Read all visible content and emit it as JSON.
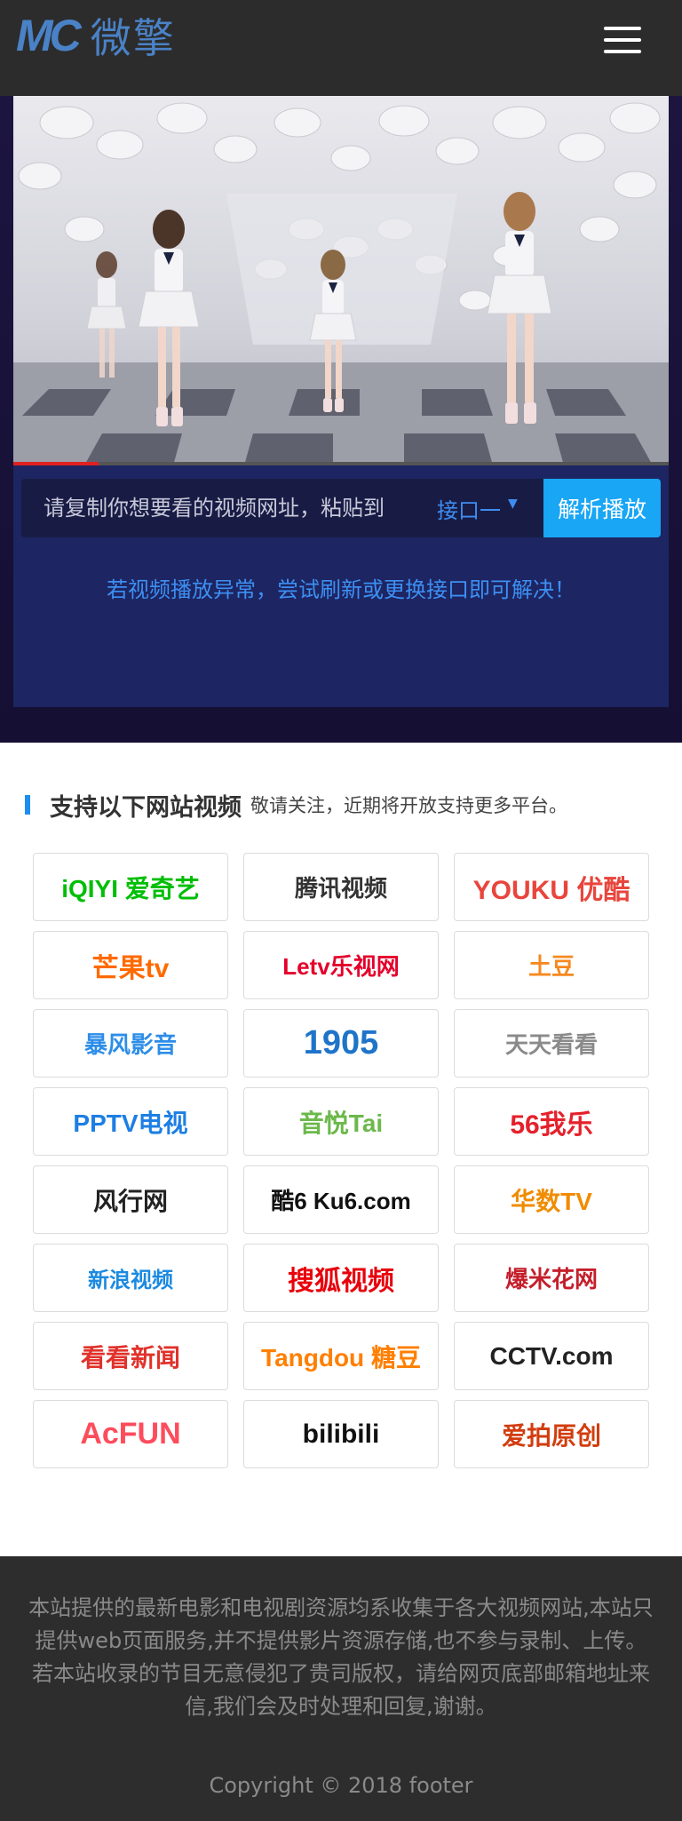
{
  "header": {
    "logo_mark": "MC",
    "logo_text": "微擎"
  },
  "player": {
    "progress": 0.13
  },
  "parse": {
    "placeholder": "请复制你想要看的视频网址，粘贴到",
    "interface_label": "接口一",
    "button_label": "解析播放",
    "tip": "若视频播放异常，尝试刷新或更换接口即可解决！"
  },
  "sites": {
    "title": "支持以下网站视频",
    "subtitle": "敬请关注，近期将开放支持更多平台。",
    "items": [
      {
        "label": "iQIYI 爱奇艺",
        "color": "#00be06"
      },
      {
        "label": "腾讯视频",
        "color": "#333333"
      },
      {
        "label": "YOUKU 优酷",
        "color": "#e8453c"
      },
      {
        "label": "芒果tv",
        "color": "#ff6a00"
      },
      {
        "label": "Letv乐视网",
        "color": "#e4002b"
      },
      {
        "label": "土豆",
        "color": "#f6891f"
      },
      {
        "label": "暴风影音",
        "color": "#2d8ee8"
      },
      {
        "label": "1905",
        "color": "#1f74c9"
      },
      {
        "label": "天天看看",
        "color": "#8a8a8a"
      },
      {
        "label": "PPTV电视",
        "color": "#1d7fe3"
      },
      {
        "label": "音悦Tai",
        "color": "#6cb84b"
      },
      {
        "label": "56我乐",
        "color": "#e5212b"
      },
      {
        "label": "风行网",
        "color": "#222222"
      },
      {
        "label": "酷6 Ku6.com",
        "color": "#111111"
      },
      {
        "label": "华数TV",
        "color": "#f08c00"
      },
      {
        "label": "新浪视频",
        "color": "#1b8ae0"
      },
      {
        "label": "搜狐视频",
        "color": "#e8000b"
      },
      {
        "label": "爆米花网",
        "color": "#c41f2b"
      },
      {
        "label": "看看新闻",
        "color": "#e0322b"
      },
      {
        "label": "Tangdou 糖豆",
        "color": "#ff7f00"
      },
      {
        "label": "CCTV.com",
        "color": "#222222"
      },
      {
        "label": "AcFUN",
        "color": "#fd4c5c"
      },
      {
        "label": "bilibili",
        "color": "#111111"
      },
      {
        "label": "爱拍原创",
        "color": "#d23d0f"
      }
    ]
  },
  "footer": {
    "text1": "本站提供的最新电影和电视剧资源均系收集于各大视频网站,本站只提供web页面服务,并不提供影片资源存储,也不参与录制、上传。",
    "text2": "若本站收录的节目无意侵犯了贵司版权，请给网页底部邮箱地址来信,我们会及时处理和回复,谢谢。",
    "copyright": "Copyright © 2018  footer"
  },
  "colors": {
    "header_bg": "#2c2c2c",
    "hero_bg": "#1c1540",
    "accent": "#19a6f5",
    "tip": "#3d8ff2"
  }
}
